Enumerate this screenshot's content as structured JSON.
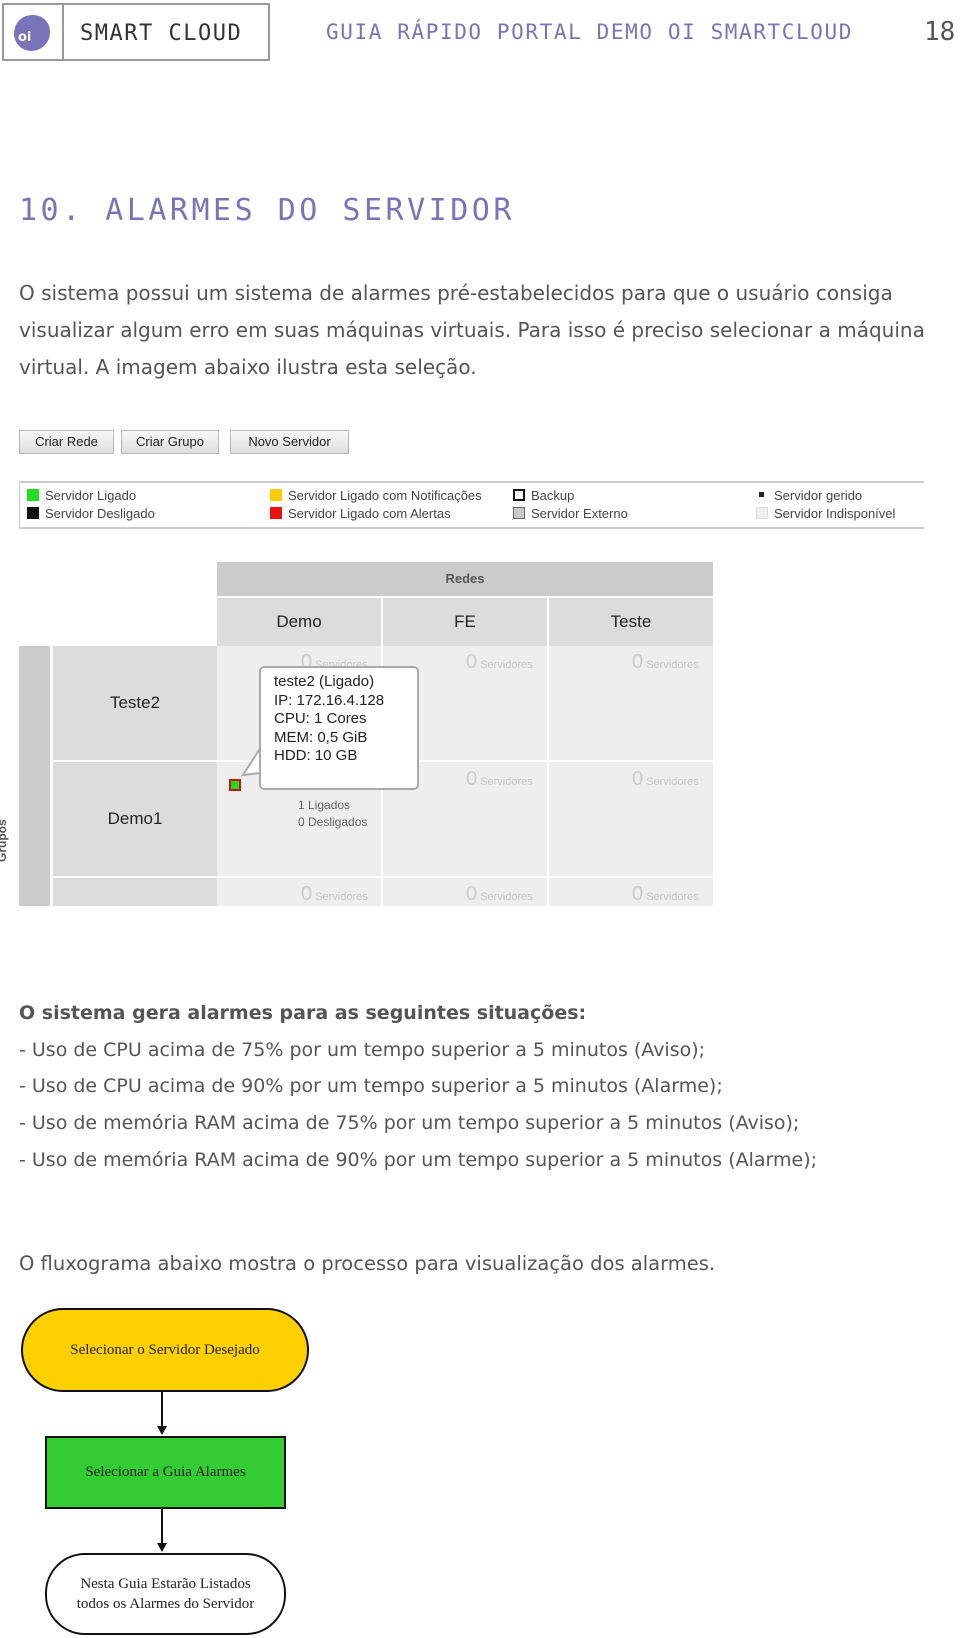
{
  "header": {
    "logo_text": "oi",
    "brand": "SMART CLOUD",
    "running_title": "GUIA RÁPIDO PORTAL DEMO OI SMARTCLOUD",
    "page_number": "18"
  },
  "section": {
    "title": "10. ALARMES DO SERVIDOR",
    "intro": "O sistema possui um sistema de alarmes pré-estabelecidos para que o usuário consiga visualizar algum erro em suas máquinas virtuais. Para isso é preciso selecionar a máquina virtual. A imagem abaixo ilustra esta seleção."
  },
  "screenshot": {
    "buttons": [
      "Criar Rede",
      "Criar Grupo",
      "Novo Servidor"
    ],
    "legend": [
      {
        "label": "Servidor Ligado",
        "icon": "green-square",
        "color": "#22dd22"
      },
      {
        "label": "Servidor Desligado",
        "icon": "black-square",
        "color": "#111111"
      },
      {
        "label": "Servidor Ligado com Notificações",
        "icon": "yellow-square",
        "color": "#ffcc00"
      },
      {
        "label": "Servidor Ligado com Alertas",
        "icon": "red-square",
        "color": "#ee1111"
      },
      {
        "label": "Backup",
        "icon": "white-outlined-square",
        "color": "#ffffff"
      },
      {
        "label": "Servidor Externo",
        "icon": "gray-square",
        "color": "#c8c8c8"
      },
      {
        "label": "Servidor gerido",
        "icon": "small-black-dot",
        "color": "#222222"
      },
      {
        "label": "Servidor Indisponível",
        "icon": "light-gray-square",
        "color": "#eeeeee"
      }
    ],
    "grid": {
      "redes_label": "Redes",
      "grupos_label": "Grupos",
      "columns": [
        "Demo",
        "FE",
        "Teste"
      ],
      "rows": [
        "Teste2",
        "Demo1",
        ""
      ],
      "empty_count": "0",
      "empty_unit": "Servidores",
      "counts": {
        "on": "1 Ligados",
        "off": "0 Desligados"
      }
    },
    "tooltip": {
      "lines": [
        "teste2 (Ligado)",
        "IP: 172.16.4.128",
        "CPU: 1 Cores",
        "MEM: 0,5 GiB",
        "HDD: 10 GB"
      ]
    }
  },
  "alarms": {
    "heading": "O sistema gera alarmes para as seguintes situações:",
    "items": [
      "- Uso de CPU acima de 75% por um tempo superior a 5 minutos (Aviso);",
      "- Uso de CPU acima de 90% por um tempo superior a 5 minutos (Alarme);",
      "- Uso de memória RAM acima de 75% por um tempo superior a 5 minutos (Aviso);",
      "- Uso de memória RAM acima de 90% por um tempo superior a 5 minutos (Alarme);"
    ]
  },
  "flowchart": {
    "intro": "O fluxograma abaixo mostra o processo para visualização dos alarmes.",
    "steps": [
      {
        "label": "Selecionar o Servidor Desejado",
        "color": "#ffd000"
      },
      {
        "label": "Selecionar a Guia Alarmes",
        "color": "#33cc33"
      },
      {
        "label_line1": "Nesta Guia Estarão Listados",
        "label_line2": "todos os Alarmes do Servidor",
        "color": "#ffffff"
      }
    ]
  }
}
